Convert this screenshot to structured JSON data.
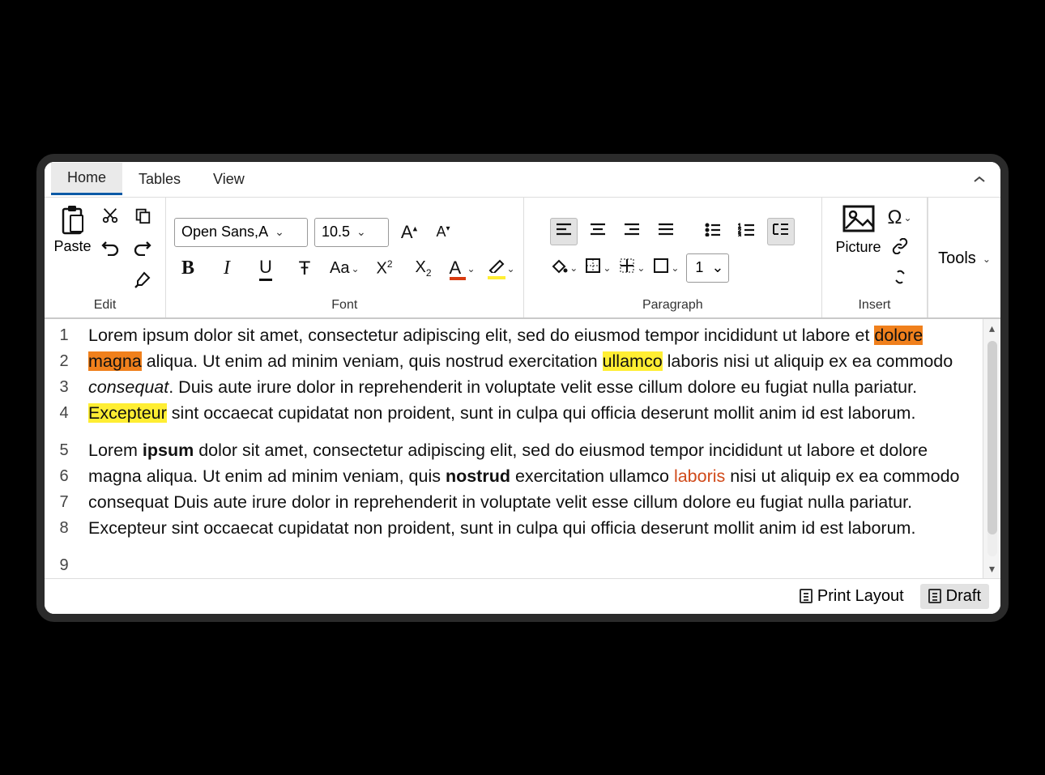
{
  "tabs": {
    "home": "Home",
    "tables": "Tables",
    "view": "View"
  },
  "groups": {
    "edit": "Edit",
    "font": "Font",
    "paragraph": "Paragraph",
    "insert": "Insert"
  },
  "edit": {
    "paste": "Paste"
  },
  "font": {
    "family": "Open Sans,A",
    "size": "10.5"
  },
  "paragraph": {
    "line_spacing": "1"
  },
  "insert": {
    "picture": "Picture"
  },
  "tools": {
    "label": "Tools"
  },
  "status": {
    "print_layout": "Print Layout",
    "draft": "Draft"
  },
  "lines": [
    "1",
    "2",
    "3",
    "4",
    "5",
    "6",
    "7",
    "8",
    "9"
  ],
  "doc": {
    "p1": {
      "t1": "Lorem ipsum dolor sit amet, consectetur adipiscing elit, sed do eiusmod tempor incididunt ut labore et ",
      "hl_orange": "dolore magna",
      "t2": " aliqua. Ut enim ad minim veniam, quis nostrud exercitation ",
      "hl_yellow1": "ullamco",
      "t3": " laboris nisi ut aliquip ex ea commodo ",
      "italic": "consequat",
      "t4": ". Duis aute irure dolor in reprehenderit in voluptate velit esse cillum dolore eu fugiat nulla pariatur. ",
      "hl_yellow2": "Excepteur",
      "t5": " sint occaecat cupidatat non proident, sunt in culpa qui officia deserunt mollit anim id est laborum."
    },
    "p2": {
      "t1": "Lorem ",
      "b1": "ipsum",
      "t2": " dolor sit amet, consectetur adipiscing elit, sed do eiusmod tempor incididunt ut labore et dolore magna aliqua. Ut enim ad minim veniam, quis ",
      "b2": "nostrud",
      "t3": " exercitation ullamco ",
      "red": "laboris",
      "t4": " nisi ut aliquip ex ea commodo consequat Duis aute irure dolor in reprehenderit in voluptate velit esse cillum dolore eu fugiat nulla pariatur. Excepteur sint occaecat cupidatat non proident, sunt in culpa qui officia deserunt mollit anim id est laborum."
    }
  }
}
